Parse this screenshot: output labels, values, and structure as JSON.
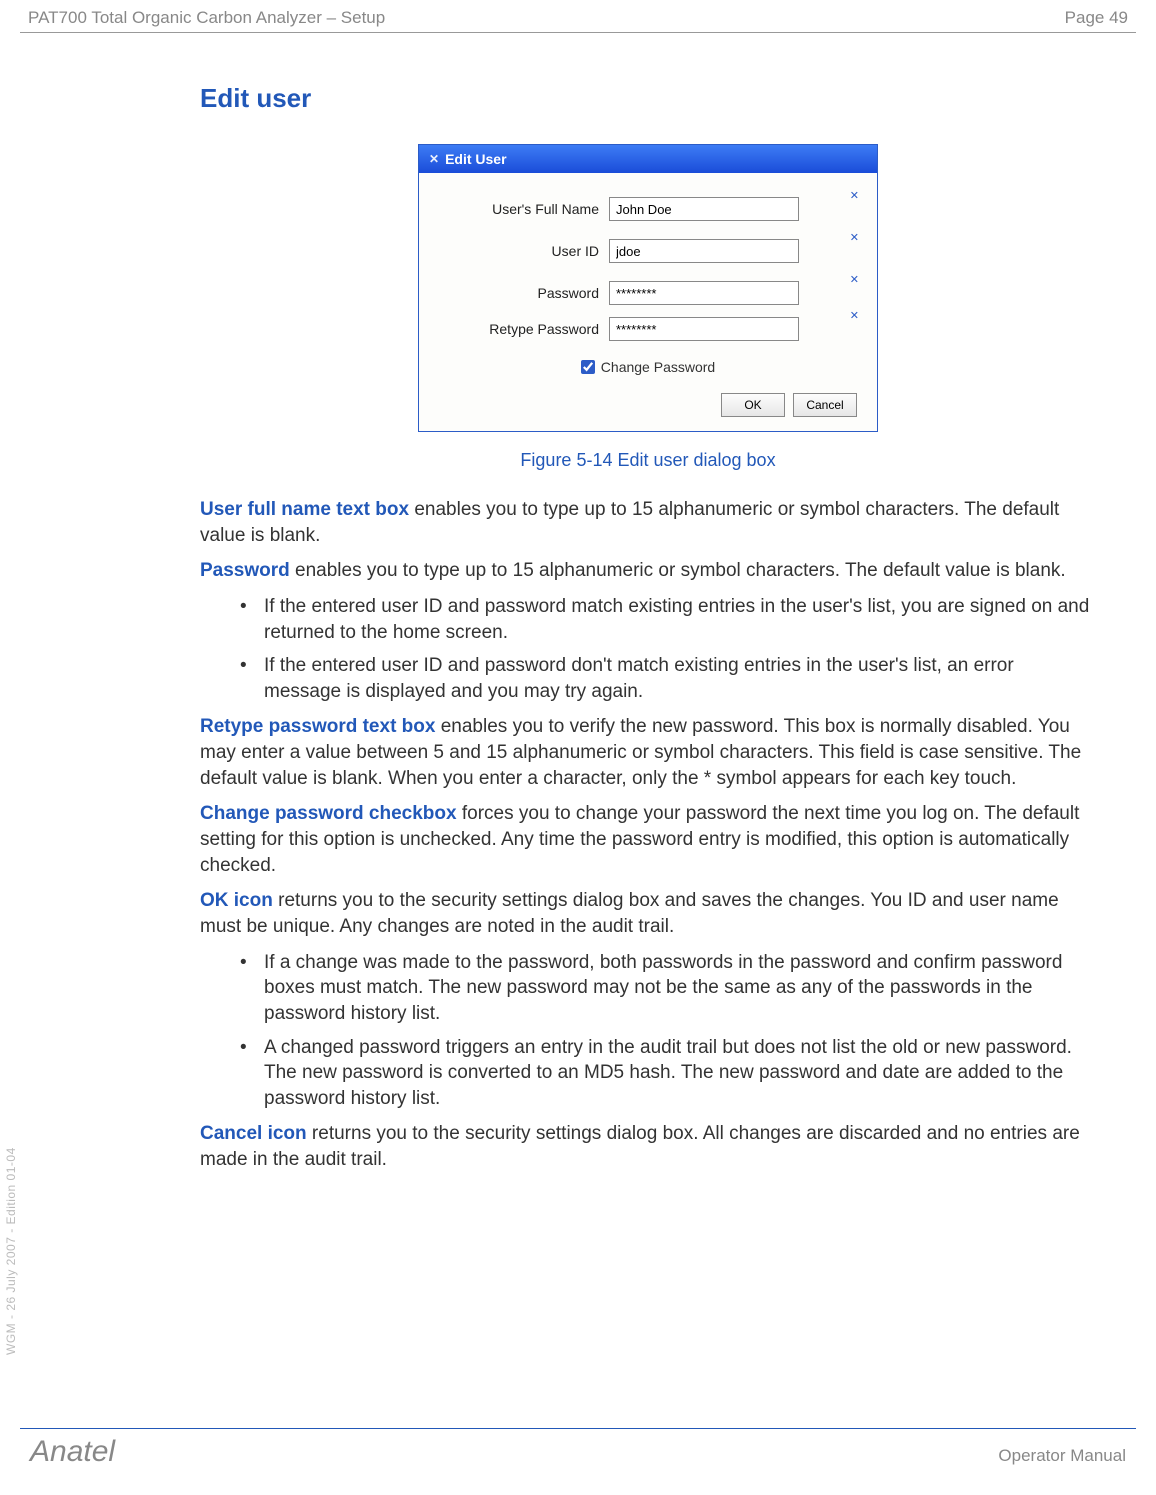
{
  "header": {
    "left": "PAT700 Total Organic Carbon Analyzer – Setup",
    "right": "Page 49"
  },
  "section_title": "Edit user",
  "dialog": {
    "title": "Edit User",
    "fields": {
      "fullname_label": "User's Full Name",
      "fullname_value": "John Doe",
      "userid_label": "User ID",
      "userid_value": "jdoe",
      "password_label": "Password",
      "password_value": "********",
      "retype_label": "Retype Password",
      "retype_value": "********",
      "changepw_label": "Change Password"
    },
    "buttons": {
      "ok": "OK",
      "cancel": "Cancel"
    }
  },
  "caption": "Figure 5-14 Edit user dialog box",
  "paras": {
    "p1_lead": "User full name text box",
    "p1_rest": " enables you to type up to 15 alphanumeric or symbol characters. The default value is blank.",
    "p2_lead": "Password",
    "p2_rest": " enables you to type up to 15 alphanumeric or symbol characters. The default value is blank.",
    "p2_b1": "If the entered user ID and password match existing entries in the user's list, you are signed on and returned to the home screen.",
    "p2_b2": "If the entered user ID and password don't match existing entries in the user's list, an error message is displayed and you may try again.",
    "p3_lead": "Retype password text box",
    "p3_rest": " enables you to verify the new password. This box is normally disabled. You may enter a value between 5 and 15 alphanumeric or symbol characters. This field is case sensitive. The default value is blank. When you enter a character, only the * symbol appears for each key touch.",
    "p4_lead": "Change password checkbox",
    "p4_rest": " forces you to change your password the next time you log on. The default setting for this option is unchecked. Any time the password entry is modified, this option is automatically checked.",
    "p5_lead": "OK icon",
    "p5_rest": " returns you to the security settings dialog box and saves the changes. You ID and user name must be unique. Any changes are noted in the audit trail.",
    "p5_b1": "If a change was made to the password, both passwords in the password and confirm password boxes must match. The new password may not be the same as any of the passwords in the password history list.",
    "p5_b2": "A changed password triggers an entry in the audit trail but does not list the old or new password. The new password is converted to an MD5 hash. The new password and date are added to the password history list.",
    "p6_lead": "Cancel icon",
    "p6_rest": " returns you to the security settings dialog box. All changes are discarded and no entries are made in the audit trail."
  },
  "vertical_note": "WGM - 26 July 2007 - Edition 01-04",
  "footer": {
    "left": "Anatel",
    "right": "Operator Manual"
  }
}
